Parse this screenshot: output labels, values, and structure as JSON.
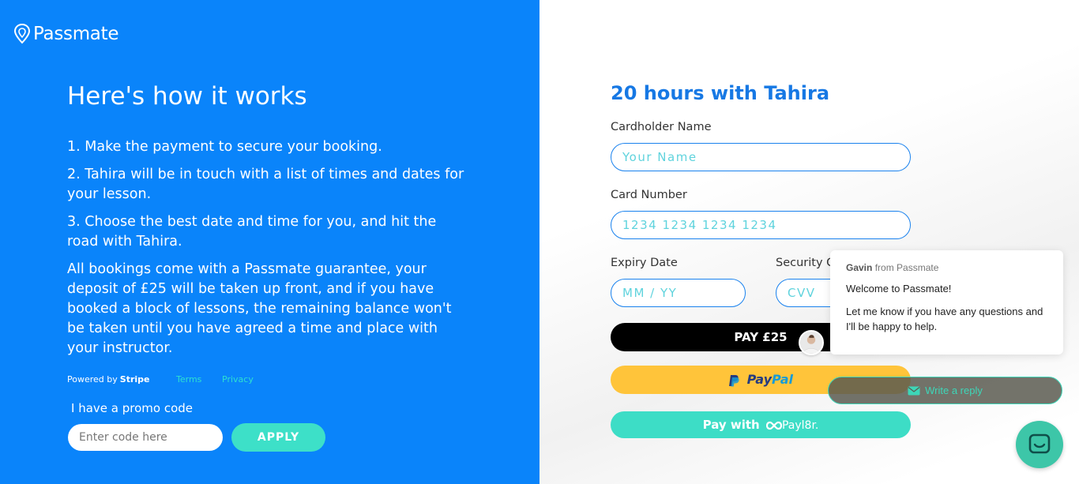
{
  "brand": {
    "name": "Passmate"
  },
  "info": {
    "title": "Here's how it works",
    "steps": [
      "1. Make the payment to secure your booking.",
      "2. Tahira will be in touch with a list of times and dates for your lesson.",
      "3. Choose the best date and time for you, and hit the road with Tahira."
    ],
    "guarantee": "All bookings come with a Passmate guarantee, your deposit of £25 will be taken up front, and if you have booked a block of lessons, the remaining balance won't be taken until you have agreed a time and place with your instructor."
  },
  "footer": {
    "powered_by": "Powered by",
    "stripe": "Stripe",
    "terms": "Terms",
    "privacy": "Privacy"
  },
  "promo": {
    "label": "I have a promo code",
    "placeholder": "Enter code here",
    "apply": "APPLY"
  },
  "form": {
    "title": "20 hours with Tahira",
    "cardholder_label": "Cardholder Name",
    "cardholder_placeholder": "Your Name",
    "card_number_label": "Card Number",
    "card_number_placeholder": "1234 1234 1234 1234",
    "expiry_label": "Expiry Date",
    "expiry_placeholder": "MM / YY",
    "security_label": "Security Code",
    "security_placeholder": "CVV",
    "pay_label": "PAY £25",
    "paypal_pay": "Pay",
    "paypal_pal": "Pal",
    "payl8r_prefix": "Pay with",
    "payl8r_brand": "Payl8r."
  },
  "chat": {
    "sender": "Gavin",
    "from_text": "from Passmate",
    "welcome": "Welcome to Passmate!",
    "message": "Let me know if you have any questions and I'll be happy to help.",
    "reply_label": "Write a reply"
  },
  "colors": {
    "left_bg": "#0a84fa",
    "accent": "#3de0c8",
    "title_blue": "#1678e4",
    "paypal_yellow": "#ffc43a"
  }
}
